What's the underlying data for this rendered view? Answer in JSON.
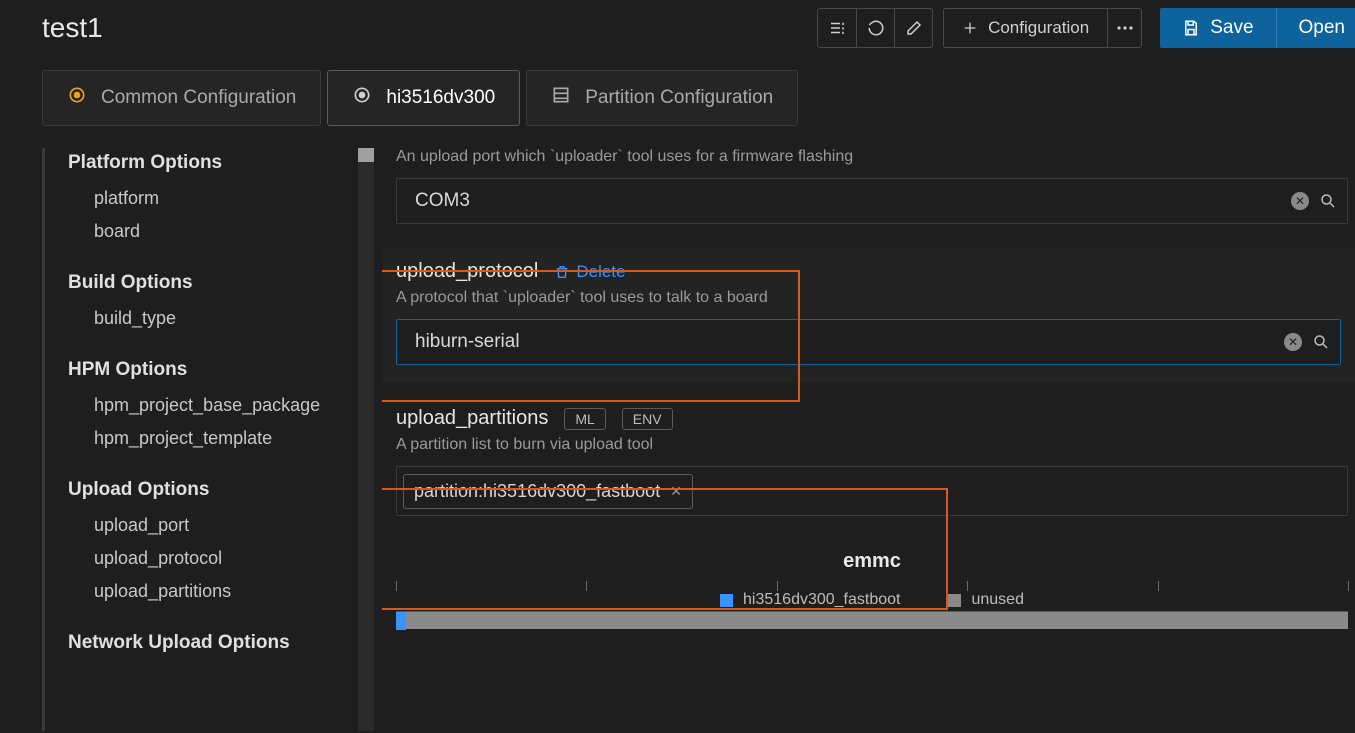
{
  "header": {
    "title": "test1",
    "configuration_label": "Configuration",
    "save_label": "Save",
    "open_label": "Open"
  },
  "tabs": [
    {
      "label": "Common Configuration"
    },
    {
      "label": "hi3516dv300"
    },
    {
      "label": "Partition Configuration"
    }
  ],
  "sidebar": {
    "sections": [
      {
        "title": "Platform Options",
        "items": [
          "platform",
          "board"
        ]
      },
      {
        "title": "Build Options",
        "items": [
          "build_type"
        ]
      },
      {
        "title": "HPM Options",
        "items": [
          "hpm_project_base_package",
          "hpm_project_template"
        ]
      },
      {
        "title": "Upload Options",
        "items": [
          "upload_port",
          "upload_protocol",
          "upload_partitions"
        ]
      },
      {
        "title": "Network Upload Options",
        "items": []
      }
    ]
  },
  "fields": {
    "upload_port": {
      "desc": "An upload port which `uploader` tool uses for a firmware flashing",
      "value": "COM3"
    },
    "upload_protocol": {
      "label": "upload_protocol",
      "delete": "Delete",
      "desc": "A protocol that `uploader` tool uses to talk to a board",
      "value": "hiburn-serial"
    },
    "upload_partitions": {
      "label": "upload_partitions",
      "badge_ml": "ML",
      "badge_env": "ENV",
      "desc": "A partition list to burn via upload tool",
      "tag": "partition:hi3516dv300_fastboot"
    }
  },
  "chart": {
    "title": "emmc",
    "legend": [
      {
        "name": "hi3516dv300_fastboot",
        "color": "#3794ff"
      },
      {
        "name": "unused",
        "color": "#8a8a8a"
      }
    ]
  },
  "chart_data": {
    "type": "bar",
    "title": "emmc",
    "series": [
      {
        "name": "hi3516dv300_fastboot",
        "value": 1
      },
      {
        "name": "unused",
        "value": 99
      }
    ],
    "xlabel": "",
    "ylabel": "",
    "ylim": [
      0,
      100
    ]
  }
}
